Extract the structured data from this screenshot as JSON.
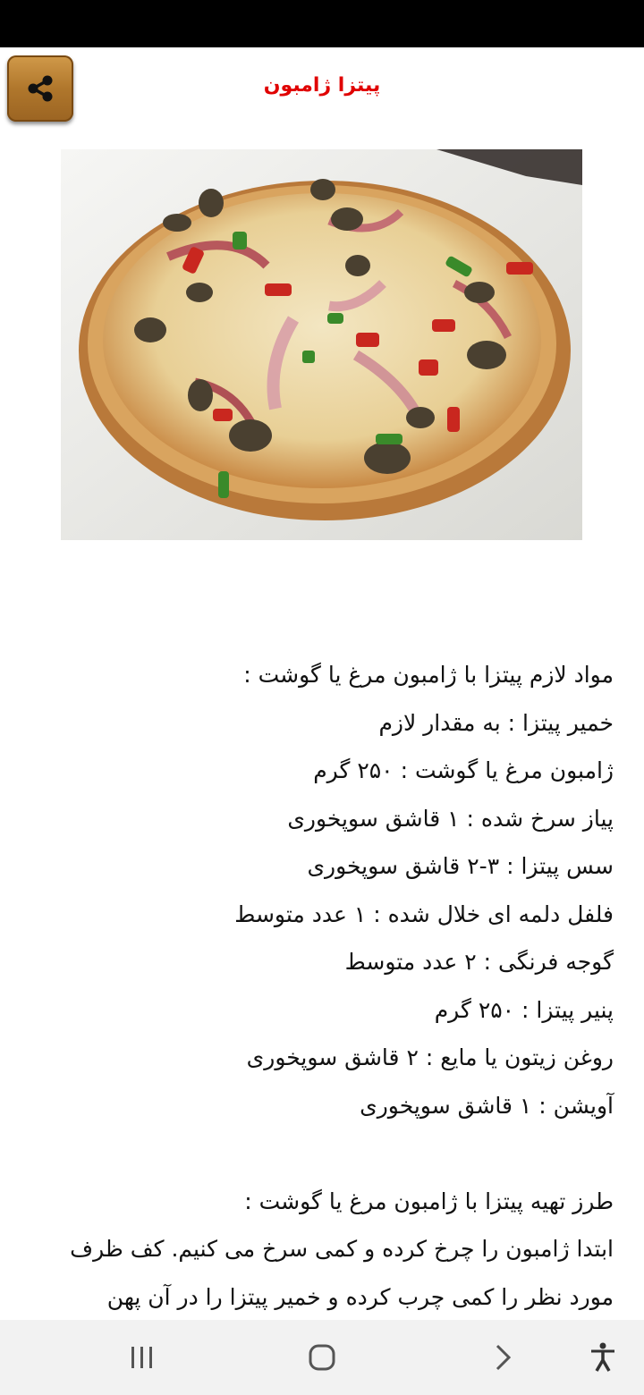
{
  "header": {
    "title": "پیتزا ژامبون",
    "share_icon": "share-icon",
    "share_button_color": "#b0772c"
  },
  "photo": {
    "icon": "pizza-photo"
  },
  "ingredients": {
    "heading": "مواد لازم پیتزا با ژامبون مرغ یا گوشت :",
    "items": [
      "خمیر پیتزا   :   به مقدار لازم",
      "ژامبون مرغ یا گوشت   :   ۲۵۰ گرم",
      "پیاز سرخ شده  :  ۱ قاشق سوپخوری",
      "سس پیتزا  :   ۳-۲ قاشق سوپخوری",
      "فلفل دلمه ای خلال شده   :   ۱ عدد متوسط",
      "گوجه فرنگی   :   ۲ عدد متوسط",
      "پنیر پیتزا   :   ۲۵۰ گرم",
      "روغن زیتون یا مایع   :   ۲ قاشق سوپخوری",
      "آویشن   :   ۱ قاشق سوپخوری"
    ]
  },
  "method": {
    "heading": "طرز تهیه پیتزا با ژامبون مرغ یا گوشت :",
    "lines": [
      "ابتدا ژامبون را چرخ کرده و کمی سرخ می کنیم. کف ظرف",
      "مورد نظر را کمی چرب کرده و خمیر پیتزا را در آن پهن"
    ]
  },
  "navbar": {
    "recent_icon": "recent-apps-icon",
    "home_icon": "home-icon",
    "back_icon": "back-icon",
    "accessibility_icon": "accessibility-icon"
  }
}
